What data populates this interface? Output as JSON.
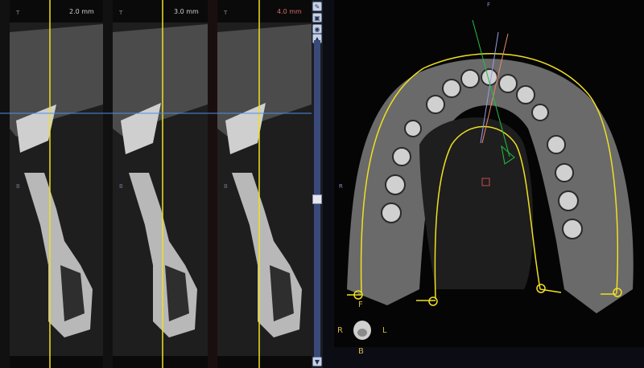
{
  "sections": [
    {
      "side_top": "T",
      "side_bottom": "B",
      "thickness": "2.0 mm"
    },
    {
      "side_top": "T",
      "side_bottom": "B",
      "thickness": "3.0 mm"
    },
    {
      "side_top": "T",
      "side_bottom": "B",
      "thickness": "4.0 mm"
    }
  ],
  "scroll": {
    "up": "▲",
    "down": "▼",
    "position": 0.5
  },
  "axial": {
    "label_top": "F",
    "label_left": "R",
    "landmark": "F",
    "orientation": {
      "right": "R",
      "left": "L",
      "bottom": "B"
    }
  },
  "colors": {
    "nerve_line": "#f0e020",
    "cross_line": "#4a90e8",
    "accent_red": "#c84a4a",
    "marker_green": "#24c040"
  }
}
